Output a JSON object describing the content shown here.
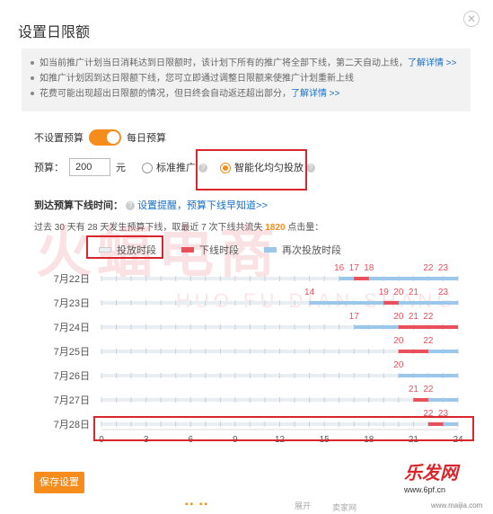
{
  "dialog": {
    "title": "设置日限额"
  },
  "notice": {
    "lines": [
      {
        "text": "如当前推广计划当日消耗达到日限额时，该计划下所有的推广将全部下线，第二天自动上线，",
        "link": "了解详情 >>"
      },
      {
        "text": "如推广计划因到达日限额下线，您可立即通过调整日限额来使推广计划重新上线",
        "link": ""
      },
      {
        "text": "花费可能出现超出日限额的情况，但日终会自动返还超出部分，",
        "link": "了解详情 >>"
      }
    ]
  },
  "budget_mode": {
    "left_label": "不设置预算",
    "right_label": "每日预算"
  },
  "budget": {
    "label": "预算：",
    "value": "200",
    "unit": "元"
  },
  "delivery": {
    "option1": "标准推广",
    "option2": "智能化均匀投放"
  },
  "offline_time": {
    "label": "到达预算下线时间：",
    "link": "设置提醒，预算下线早知道>>"
  },
  "summary": {
    "prefix": "过去 30 天有 28 天发生预算下线，取最近 7 次下线共流失 ",
    "count": "1820",
    "suffix": " 点击量："
  },
  "legend": {
    "item1": "投放时段",
    "item2": "下线时段",
    "item3": "再次投放时段"
  },
  "chart_data": {
    "type": "timeline",
    "x_ticks": [
      "0",
      "3",
      "6",
      "9",
      "12",
      "15",
      "18",
      "21",
      "24"
    ],
    "xlim": [
      0,
      24
    ],
    "rows": [
      {
        "date": "7月22日",
        "offline": [
          [
            17,
            18
          ]
        ],
        "relaunch": [
          [
            16,
            24
          ]
        ],
        "labels": [
          "16",
          "17",
          "18",
          "22",
          "23"
        ]
      },
      {
        "date": "7月23日",
        "offline": [
          [
            19,
            20
          ]
        ],
        "relaunch": [
          [
            14,
            24
          ]
        ],
        "labels": [
          "14",
          "19",
          "20",
          "21",
          "23"
        ]
      },
      {
        "date": "7月24日",
        "offline": [
          [
            20,
            24
          ]
        ],
        "relaunch": [
          [
            17,
            24
          ]
        ],
        "labels": [
          "17",
          "20",
          "21",
          "22"
        ]
      },
      {
        "date": "7月25日",
        "offline": [
          [
            20,
            22
          ]
        ],
        "relaunch": [
          [
            22,
            24
          ]
        ],
        "labels": [
          "20",
          "22"
        ]
      },
      {
        "date": "7月26日",
        "offline": [],
        "relaunch": [
          [
            20,
            24
          ]
        ],
        "labels": [
          "20"
        ]
      },
      {
        "date": "7月27日",
        "offline": [
          [
            21,
            22
          ]
        ],
        "relaunch": [
          [
            22,
            24
          ]
        ],
        "labels": [
          "21",
          "22"
        ]
      },
      {
        "date": "7月28日",
        "offline": [
          [
            22,
            23
          ]
        ],
        "relaunch": [
          [
            23,
            24
          ]
        ],
        "labels": [
          "22",
          "23"
        ]
      }
    ],
    "colors": {
      "base": "#e9eef3",
      "offline": "#e8505b",
      "relaunch": "#9bc7ea",
      "label": "#e8505b"
    }
  },
  "actions": {
    "save": "保存设置"
  },
  "watermark": {
    "cn": "火蝠电商",
    "en": "HUO FU DIAN SHANG"
  },
  "overlay": {
    "brand": "乐发网",
    "brand_url": "www.6pf.cn",
    "footer_url": "www.maijia.com",
    "footer_left": "卖家网",
    "footer_center": "展开"
  }
}
